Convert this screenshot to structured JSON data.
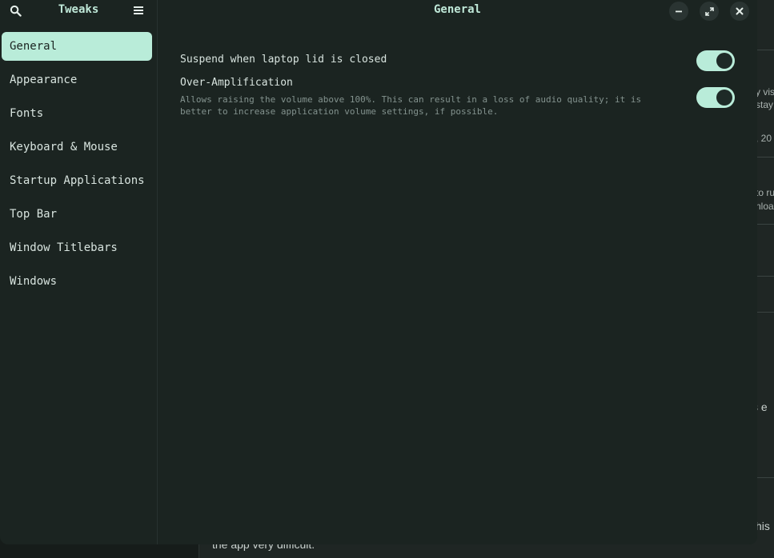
{
  "background": {
    "fragments": [
      "y vis",
      "stay",
      ", 20",
      "to ru",
      "nloa",
      "s  e",
      "his"
    ],
    "bottom_text": "the app very difficult."
  },
  "sidebar": {
    "title": "Tweaks",
    "items": [
      {
        "label": "General",
        "active": true
      },
      {
        "label": "Appearance"
      },
      {
        "label": "Fonts"
      },
      {
        "label": "Keyboard & Mouse"
      },
      {
        "label": "Startup Applications"
      },
      {
        "label": "Top Bar"
      },
      {
        "label": "Window Titlebars"
      },
      {
        "label": "Windows"
      }
    ]
  },
  "content": {
    "title": "General",
    "settings": [
      {
        "label": "Suspend when laptop lid is closed",
        "enabled": true
      },
      {
        "label": "Over-Amplification",
        "description": "Allows raising the volume above 100%. This can result in a loss of audio quality; it is better to increase application volume settings, if possible.",
        "enabled": true
      }
    ]
  },
  "icons": {
    "search": "search-icon",
    "menu": "hamburger-menu-icon",
    "minimize": "minimize-icon",
    "maximize": "maximize-icon",
    "close": "close-icon"
  },
  "colors": {
    "accent": "#b9ecd9",
    "window_bg": "#1b2421",
    "text": "#d8e4df",
    "muted": "#83928e"
  }
}
